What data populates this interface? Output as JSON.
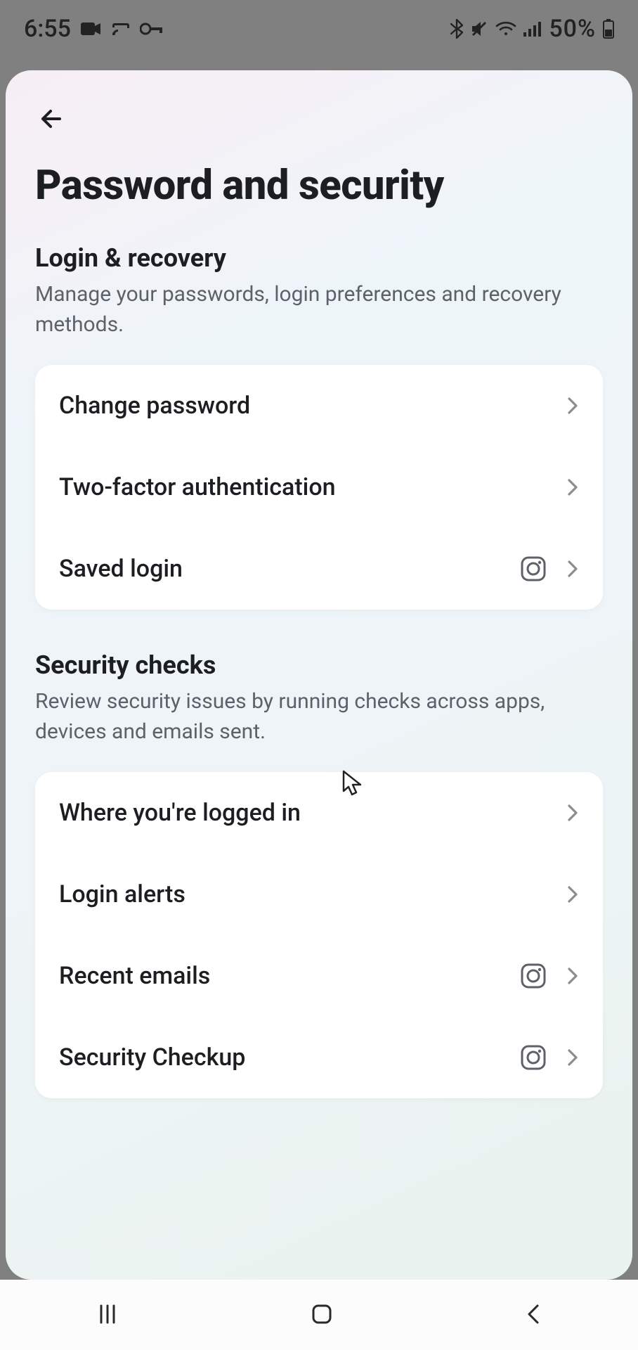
{
  "status": {
    "time": "6:55",
    "battery": "50%"
  },
  "page": {
    "title": "Password and security"
  },
  "sections": [
    {
      "title": "Login & recovery",
      "description": "Manage your passwords, login preferences and recovery methods.",
      "items": [
        {
          "label": "Change password",
          "trailing_icon": null
        },
        {
          "label": "Two-factor authentication",
          "trailing_icon": null
        },
        {
          "label": "Saved login",
          "trailing_icon": "instagram"
        }
      ]
    },
    {
      "title": "Security checks",
      "description": "Review security issues by running checks across apps, devices and emails sent.",
      "items": [
        {
          "label": "Where you're logged in",
          "trailing_icon": null
        },
        {
          "label": "Login alerts",
          "trailing_icon": null
        },
        {
          "label": "Recent emails",
          "trailing_icon": "instagram"
        },
        {
          "label": "Security Checkup",
          "trailing_icon": "instagram"
        }
      ]
    }
  ]
}
